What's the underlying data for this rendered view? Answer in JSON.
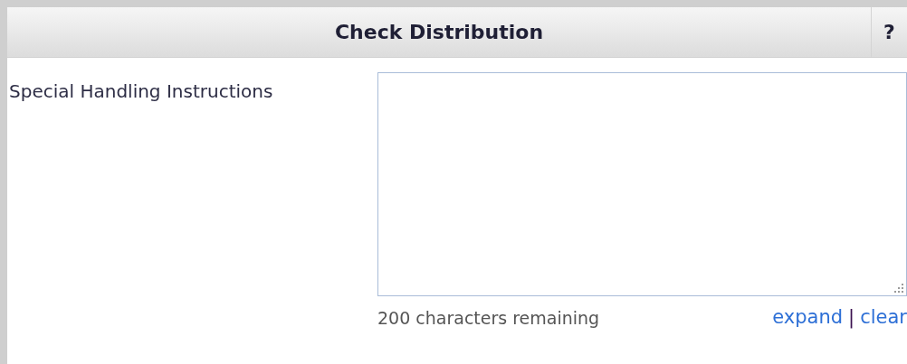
{
  "panel": {
    "title": "Check Distribution",
    "help": "?"
  },
  "field": {
    "label": "Special Handling Instructions",
    "counter": "200 characters remaining",
    "links": [
      "expand",
      "clear"
    ],
    "separator": "|"
  }
}
